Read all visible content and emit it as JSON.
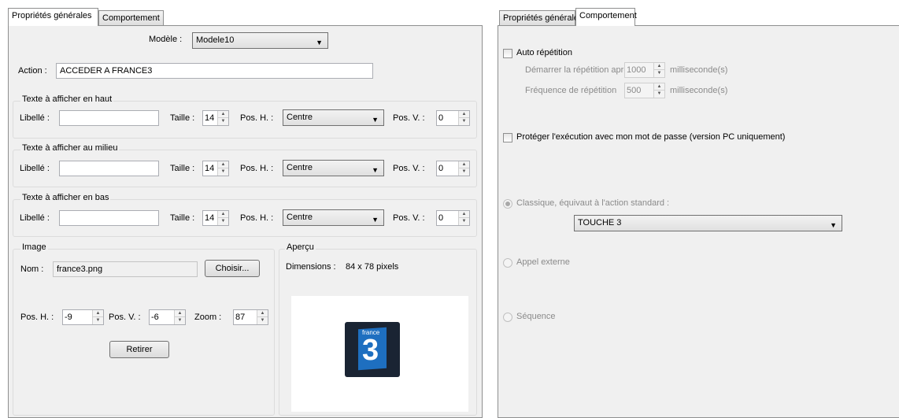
{
  "left": {
    "tabs": [
      "Propriétés générales",
      "Comportement"
    ],
    "modele": {
      "label": "Modèle :",
      "value": "Modele10"
    },
    "action": {
      "label": "Action :",
      "value": "ACCEDER A FRANCE3"
    },
    "sections": [
      {
        "title": "Texte à afficher en haut",
        "libelle_label": "Libellé :",
        "libelle_value": "",
        "taille_label": "Taille :",
        "taille_value": "14",
        "posh_label": "Pos. H. :",
        "posh_value": "Centre",
        "posv_label": "Pos. V. :",
        "posv_value": "0"
      },
      {
        "title": "Texte à afficher au milieu",
        "libelle_label": "Libellé :",
        "libelle_value": "",
        "taille_label": "Taille :",
        "taille_value": "14",
        "posh_label": "Pos. H. :",
        "posh_value": "Centre",
        "posv_label": "Pos. V. :",
        "posv_value": "0"
      },
      {
        "title": "Texte à afficher en bas",
        "libelle_label": "Libellé :",
        "libelle_value": "",
        "taille_label": "Taille :",
        "taille_value": "14",
        "posh_label": "Pos. H. :",
        "posh_value": "Centre",
        "posv_label": "Pos. V. :",
        "posv_value": "0"
      }
    ],
    "image": {
      "title": "Image",
      "nom_label": "Nom :",
      "nom_value": "france3.png",
      "choose_button": "Choisir...",
      "posh_label": "Pos. H. :",
      "posh_value": "-9",
      "posv_label": "Pos. V. :",
      "posv_value": "-6",
      "zoom_label": "Zoom :",
      "zoom_value": "87",
      "remove_button": "Retirer"
    },
    "preview": {
      "title": "Aperçu",
      "dimensions_label": "Dimensions :",
      "dimensions_value": "84 x 78 pixels",
      "logo_top": "france",
      "logo_num": "3",
      "logo_colors": {
        "bg": "#1a2433",
        "blue": "#1e6fc0"
      }
    }
  },
  "right": {
    "tabs": [
      "Propriétés générales",
      "Comportement"
    ],
    "auto_repeat": {
      "label": "Auto répétition",
      "start_label": "Démarrer la répétition après",
      "start_value": "1000",
      "freq_label": "Fréquence de répétition",
      "freq_value": "500",
      "unit": "milliseconde(s)"
    },
    "protect": {
      "label": "Protéger l'exécution avec mon mot de passe (version PC uniquement)"
    },
    "classic": {
      "label": "Classique, équivaut à l'action standard :",
      "value": "TOUCHE 3"
    },
    "external": {
      "label": "Appel externe"
    },
    "sequence": {
      "label": "Séquence"
    }
  }
}
